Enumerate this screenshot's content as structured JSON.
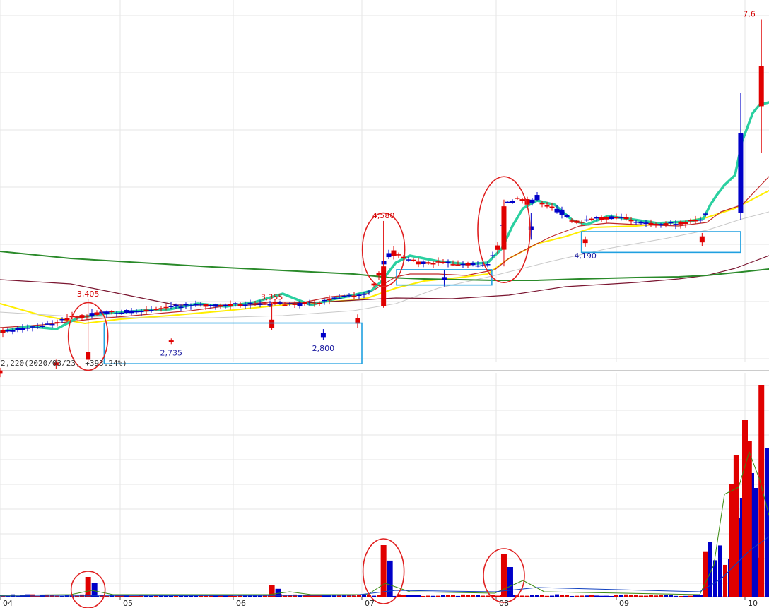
{
  "chart_data": {
    "type": "candlestick-with-volume",
    "x_ticks": [
      "04",
      "05",
      "06",
      "07",
      "08",
      "09",
      "10"
    ],
    "info_text": "2,220(2020/03/23, +393.24%)",
    "price_annotations": [
      {
        "text": "3,405",
        "x": "04-23",
        "y": 3405,
        "color": "red"
      },
      {
        "text": "3,355",
        "x": "06-10",
        "y": 3355,
        "color": "red"
      },
      {
        "text": "2,735",
        "x": "05-15",
        "y": 2735,
        "color": "blue"
      },
      {
        "text": "2,800",
        "x": "06-22",
        "y": 2800,
        "color": "blue"
      },
      {
        "text": "4,580",
        "x": "07-06",
        "y": 4580,
        "color": "red"
      },
      {
        "text": "4,190",
        "x": "08-24",
        "y": 4190,
        "color": "blue"
      },
      {
        "text": "7,6",
        "x": "10-05",
        "y": 7600,
        "color": "red"
      }
    ],
    "candles_summary": [
      {
        "date": "04-01",
        "open": 2300,
        "high": 2380,
        "low": 2240,
        "close": 2340
      },
      {
        "date": "04-15",
        "open": 2420,
        "high": 2500,
        "low": 2360,
        "close": 2460
      },
      {
        "date": "04-23",
        "open": 2500,
        "high": 3405,
        "low": 2460,
        "close": 2620
      },
      {
        "date": "05-15",
        "open": 2760,
        "high": 2820,
        "low": 2735,
        "close": 2790
      },
      {
        "date": "06-10",
        "open": 2980,
        "high": 3355,
        "low": 2950,
        "close": 3100
      },
      {
        "date": "06-22",
        "open": 2900,
        "high": 2960,
        "low": 2800,
        "close": 2840
      },
      {
        "date": "06-30",
        "open": 3040,
        "high": 3180,
        "low": 2980,
        "close": 3120
      },
      {
        "date": "07-06",
        "open": 3300,
        "high": 4580,
        "low": 3280,
        "close": 3900
      },
      {
        "date": "07-20",
        "open": 3740,
        "high": 3840,
        "low": 3600,
        "close": 3700
      },
      {
        "date": "08-03",
        "open": 4150,
        "high": 4900,
        "low": 3900,
        "close": 4800
      },
      {
        "date": "08-10",
        "open": 4500,
        "high": 4700,
        "low": 4300,
        "close": 4450
      },
      {
        "date": "08-24",
        "open": 4250,
        "high": 4350,
        "low": 4190,
        "close": 4300
      },
      {
        "date": "09-21",
        "open": 4260,
        "high": 4400,
        "low": 4200,
        "close": 4350
      },
      {
        "date": "09-30",
        "open": 5900,
        "high": 6500,
        "low": 4600,
        "close": 4700
      },
      {
        "date": "10-05",
        "open": 6300,
        "high": 7600,
        "low": 5600,
        "close": 6900
      }
    ],
    "volume_spikes": [
      {
        "date": "04-23",
        "value": 28
      },
      {
        "date": "06-10",
        "value": 16
      },
      {
        "date": "07-06",
        "value": 73
      },
      {
        "date": "08-03",
        "value": 60
      },
      {
        "date": "09-28",
        "value": 160
      },
      {
        "date": "09-29",
        "value": 200
      },
      {
        "date": "10-01",
        "value": 250
      },
      {
        "date": "10-02",
        "value": 220
      },
      {
        "date": "10-05",
        "value": 300
      }
    ],
    "colors": {
      "up": "#e00000",
      "down": "#0000c8",
      "ma_fast": "#2ad0a0",
      "ma5": "#ffee00",
      "ma_long": "#2a8a2a",
      "ma_dark": "#7a1530",
      "box": "#1fa0e0",
      "circle": "#e02020"
    }
  }
}
